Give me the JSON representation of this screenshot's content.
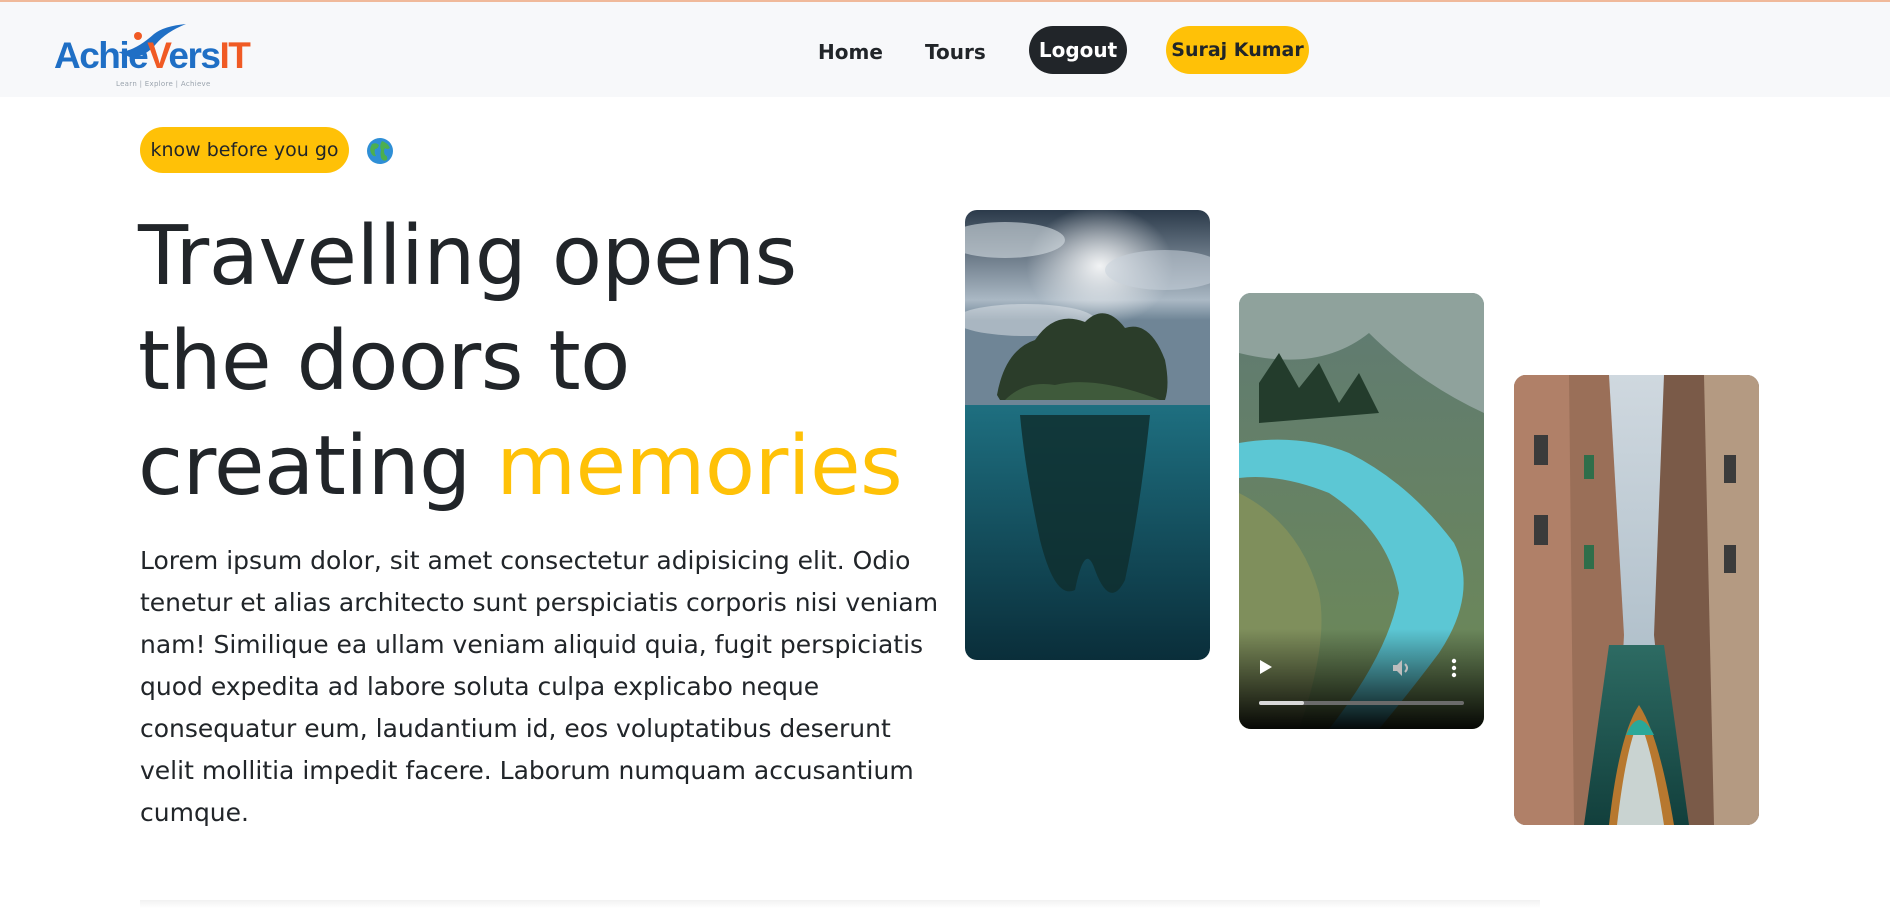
{
  "navbar": {
    "logo": {
      "text_part1": "Achie",
      "text_part2": "ers",
      "text_part3": "IT",
      "tagline": "Learn | Explore | Achieve"
    },
    "links": [
      {
        "label": "Home"
      },
      {
        "label": "Tours"
      }
    ],
    "logout_label": "Logout",
    "user_label": "Suraj Kumar"
  },
  "hero": {
    "badge_label": "know before you go",
    "badge_icon": "globe-icon",
    "headline_line1": "Travelling opens",
    "headline_line2": "the doors to",
    "headline_line3_plain": "creating ",
    "headline_line3_accent": "memories",
    "description": "Lorem ipsum dolor, sit amet consectetur adipisicing elit. Odio tenetur et alias architecto sunt perspiciatis corporis nisi veniam nam! Similique ea ullam veniam aliquid quia, fugit perspiciatis quod expedita ad labore soluta culpa explicabo neque consequatur eum, laudantium id, eos voluptatibus deserunt velit mollitia impedit facere. Laborum numquam accusantium cumque."
  },
  "media": {
    "video_progress": 0.22
  },
  "colors": {
    "accent": "#ffc107",
    "dark": "#212529",
    "navbar_bg": "#f7f8fa",
    "logo_blue": "#1f6fc5",
    "logo_orange": "#f05a24"
  }
}
